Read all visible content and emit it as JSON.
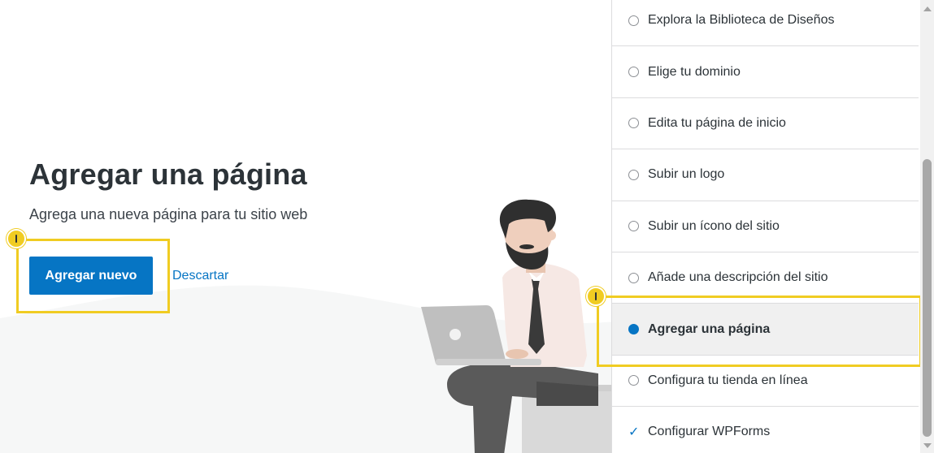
{
  "main": {
    "title": "Agregar una página",
    "subtitle": "Agrega una nueva página para tu sitio web",
    "primary_button": "Agregar nuevo",
    "dismiss_link": "Descartar"
  },
  "checklist": {
    "tasks": [
      {
        "label": "Explora la Biblioteca de Diseños",
        "state": "pending"
      },
      {
        "label": "Elige tu dominio",
        "state": "pending"
      },
      {
        "label": "Edita tu página de inicio",
        "state": "pending"
      },
      {
        "label": "Subir un logo",
        "state": "pending"
      },
      {
        "label": "Subir un ícono del sitio",
        "state": "pending"
      },
      {
        "label": "Añade una descripción del sitio",
        "state": "pending"
      },
      {
        "label": "Agregar una página",
        "state": "active"
      },
      {
        "label": "Configura tu tienda en línea",
        "state": "pending"
      },
      {
        "label": "Configurar WPForms",
        "state": "done"
      }
    ]
  },
  "colors": {
    "accent": "#0675c4",
    "highlight": "#f0cc22",
    "text": "#2c3338"
  },
  "icons": {
    "task_pending": "circle-outline-icon",
    "task_active": "filled-circle-icon",
    "task_done": "checkmark-icon",
    "marker": "info-marker-icon"
  }
}
